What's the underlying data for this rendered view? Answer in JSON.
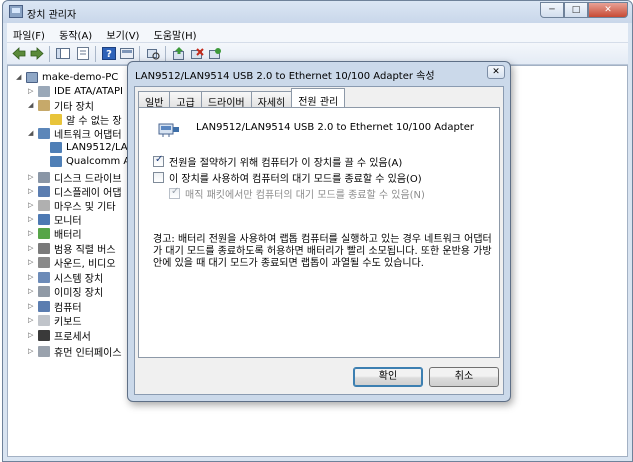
{
  "window": {
    "title": "장치 관리자"
  },
  "menu": [
    "파일(F)",
    "동작(A)",
    "보기(V)",
    "도움말(H)"
  ],
  "tree": {
    "root": "make-demo-PC",
    "items": [
      "IDE ATA/ATAPI",
      "기타 장치",
      "알 수 없는 장",
      "네트워크 어댑터",
      "LAN9512/LA",
      "Qualcomm A",
      "디스크 드라이브",
      "디스플레이 어댑",
      "마우스 및 기타",
      "모니터",
      "배터리",
      "범용 직렬 버스",
      "사운드, 비디오",
      "시스템 장치",
      "이미징 장치",
      "컴퓨터",
      "키보드",
      "프로세서",
      "휴먼 인터페이스"
    ]
  },
  "dialog": {
    "title": "LAN9512/LAN9514 USB 2.0 to Ethernet 10/100 Adapter 속성",
    "close": "✕",
    "tabs": [
      "일반",
      "고급",
      "드라이버",
      "자세히",
      "전원 관리"
    ],
    "device_name": "LAN9512/LAN9514 USB 2.0 to Ethernet 10/100 Adapter",
    "options": [
      {
        "label": "전원을 절약하기 위해 컴퓨터가 이 장치를 끌 수 있음(A)",
        "checked": true
      },
      {
        "label": "이 장치를 사용하여 컴퓨터의 대기 모드를 종료할 수 있음(O)",
        "checked": false
      },
      {
        "label": "매직 패킷에서만 컴퓨터의 대기 모드를 종료할 수 있음(N)",
        "checked": true
      }
    ],
    "warning": "경고: 배터리 전원을 사용하여 랩톱 컴퓨터를 실행하고 있는 경우 네트워크 어댑터가 대기 모드를 종료하도록 허용하면 배터리가 빨리 소모됩니다. 또한 운반용 가방 안에 있을 때 대기 모드가 종료되면 랩톱이 과열될 수도 있습니다.",
    "ok": "확인",
    "cancel": "취소"
  }
}
